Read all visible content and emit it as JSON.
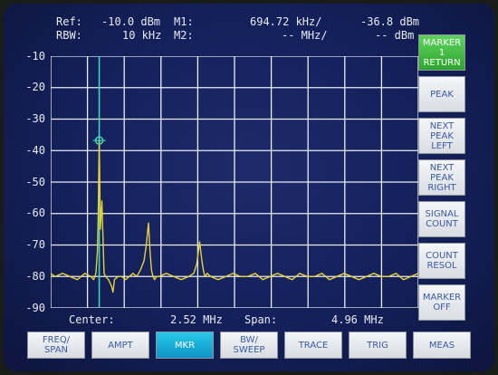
{
  "header": {
    "ref_label": "Ref:",
    "ref_value": "-10.0 dBm",
    "m1_label": "M1:",
    "m1_freq": "694.72 kHz/",
    "m1_level": "-36.8 dBm",
    "rbw_label": "RBW:",
    "rbw_value": "10 kHz",
    "m2_label": "M2:",
    "m2_freq": "-- MHz/",
    "m2_level": "-- dBm"
  },
  "y_ticks": [
    "-10",
    "-20",
    "-30",
    "-40",
    "-50",
    "-60",
    "-70",
    "-80",
    "-90"
  ],
  "footer": {
    "center_label": "Center:",
    "center_value": "2.52 MHz",
    "span_label": "Span:",
    "span_value": "4.96 MHz"
  },
  "softkeys": [
    {
      "label": "MARKER 1\nRETURN",
      "active": true
    },
    {
      "label": "PEAK",
      "active": false
    },
    {
      "label": "NEXT\nPEAK\nLEFT",
      "active": false
    },
    {
      "label": "NEXT\nPEAK\nRIGHT",
      "active": false
    },
    {
      "label": "SIGNAL\nCOUNT",
      "active": false
    },
    {
      "label": "COUNT\nRESOL",
      "active": false
    },
    {
      "label": "MARKER\nOFF",
      "active": false
    }
  ],
  "hardkeys": [
    {
      "label": "FREQ/\nSPAN",
      "active": false
    },
    {
      "label": "AMPT",
      "active": false
    },
    {
      "label": "MKR",
      "active": true
    },
    {
      "label": "BW/\nSWEEP",
      "active": false
    },
    {
      "label": "TRACE",
      "active": false
    },
    {
      "label": "TRIG",
      "active": false
    },
    {
      "label": "MEAS",
      "active": false
    }
  ],
  "colors": {
    "screen_bg": "#15215c",
    "grid": "#e9edf5",
    "trace": "#e6d03a",
    "marker": "#41d6b4",
    "softkey_active": "#3dbb3d",
    "hardkey_active": "#19b1dc"
  },
  "chart_data": {
    "type": "line",
    "xlabel": "",
    "ylabel": "",
    "x_unit": "MHz",
    "y_unit": "dBm",
    "xlim": [
      0.04,
      5.0
    ],
    "ylim": [
      -90,
      -10
    ],
    "grid": true,
    "marker": {
      "name": "M1",
      "x": 0.69472,
      "y": -36.8
    },
    "series": [
      {
        "x": [
          0.04,
          0.1,
          0.2,
          0.3,
          0.4,
          0.5,
          0.58,
          0.62,
          0.65,
          0.67,
          0.68,
          0.69,
          0.695,
          0.7,
          0.71,
          0.73,
          0.75,
          0.76,
          0.78,
          0.82,
          0.86,
          0.88,
          0.9,
          0.95,
          1.0,
          1.05,
          1.1,
          1.15,
          1.2,
          1.25,
          1.3,
          1.33,
          1.36,
          1.38,
          1.4,
          1.42,
          1.44,
          1.47,
          1.5,
          1.6,
          1.7,
          1.8,
          1.9,
          1.97,
          2.01,
          2.05,
          2.08,
          2.1,
          2.12,
          2.15,
          2.2,
          2.3,
          2.4,
          2.5,
          2.6,
          2.7,
          2.8,
          2.9,
          3.0,
          3.1,
          3.2,
          3.3,
          3.4,
          3.5,
          3.6,
          3.7,
          3.8,
          3.9,
          4.0,
          4.1,
          4.2,
          4.3,
          4.4,
          4.5,
          4.6,
          4.7,
          4.8,
          4.9,
          5.0
        ],
        "values": [
          -79,
          -80,
          -79,
          -80,
          -81,
          -79,
          -80,
          -81,
          -79,
          -72,
          -62,
          -44,
          -36.8,
          -45,
          -65,
          -56,
          -71,
          -79,
          -80,
          -81,
          -83,
          -85,
          -81,
          -80,
          -80,
          -81,
          -80,
          -79,
          -80,
          -78,
          -75,
          -70,
          -63,
          -72,
          -78,
          -80,
          -81,
          -80,
          -80,
          -79,
          -80,
          -81,
          -80,
          -79,
          -76,
          -69,
          -75,
          -78,
          -80,
          -79,
          -80,
          -81,
          -80,
          -79,
          -80,
          -80,
          -79,
          -81,
          -80,
          -79,
          -80,
          -81,
          -79,
          -80,
          -80,
          -79,
          -81,
          -80,
          -79,
          -80,
          -81,
          -80,
          -79,
          -80,
          -80,
          -79,
          -81,
          -80,
          -79
        ]
      }
    ]
  }
}
